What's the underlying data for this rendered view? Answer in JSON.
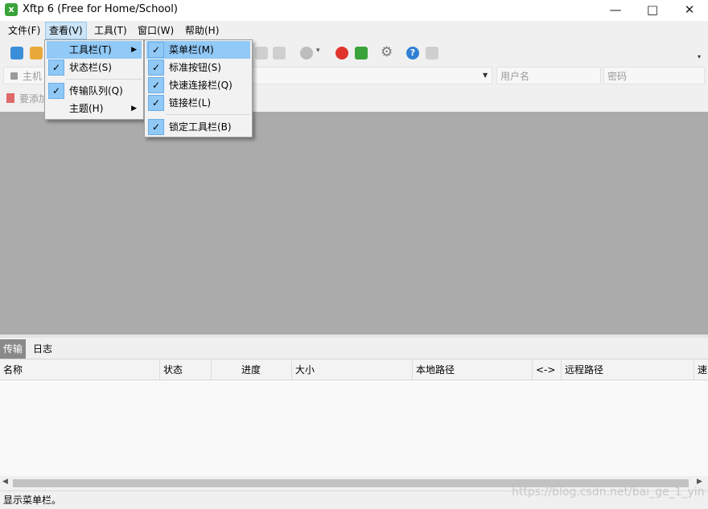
{
  "window": {
    "title": "Xftp 6 (Free for Home/School)"
  },
  "menubar": {
    "items": [
      "文件(F)",
      "查看(V)",
      "工具(T)",
      "窗口(W)",
      "帮助(H)"
    ]
  },
  "quick_connect": {
    "host_placeholder": "主机",
    "username_placeholder": "用户名",
    "password_placeholder": "密码"
  },
  "link_bar": {
    "text": "要添加"
  },
  "view_menu": {
    "items": [
      "工具栏(T)",
      "状态栏(S)",
      "传输队列(Q)",
      "主题(H)"
    ]
  },
  "toolbar_submenu": {
    "items": [
      "菜单栏(M)",
      "标准按钮(S)",
      "快速连接栏(Q)",
      "链接栏(L)",
      "锁定工具栏(B)"
    ]
  },
  "transfer_panel": {
    "tabs": [
      "传输",
      "日志"
    ],
    "columns": [
      "名称",
      "状态",
      "进度",
      "大小",
      "本地路径",
      "<->",
      "远程路径",
      "速"
    ]
  },
  "statusbar": {
    "text": "显示菜单栏。"
  },
  "watermark": "https://blog.csdn.net/bai_ge_1_yin",
  "colors": {
    "menu_highlight": "#91c9f7",
    "check_bg": "#90c8f6",
    "workspace": "#ababab"
  },
  "icons": [
    "app-icon",
    "minimize-icon",
    "maximize-icon",
    "close-icon",
    "new-session-icon",
    "open-folder-icon",
    "lock-icon",
    "stop-icon",
    "xshell-icon",
    "xftp-icon",
    "gear-icon",
    "help-icon",
    "chat-icon",
    "checkmark-icon",
    "submenu-arrow-icon"
  ]
}
